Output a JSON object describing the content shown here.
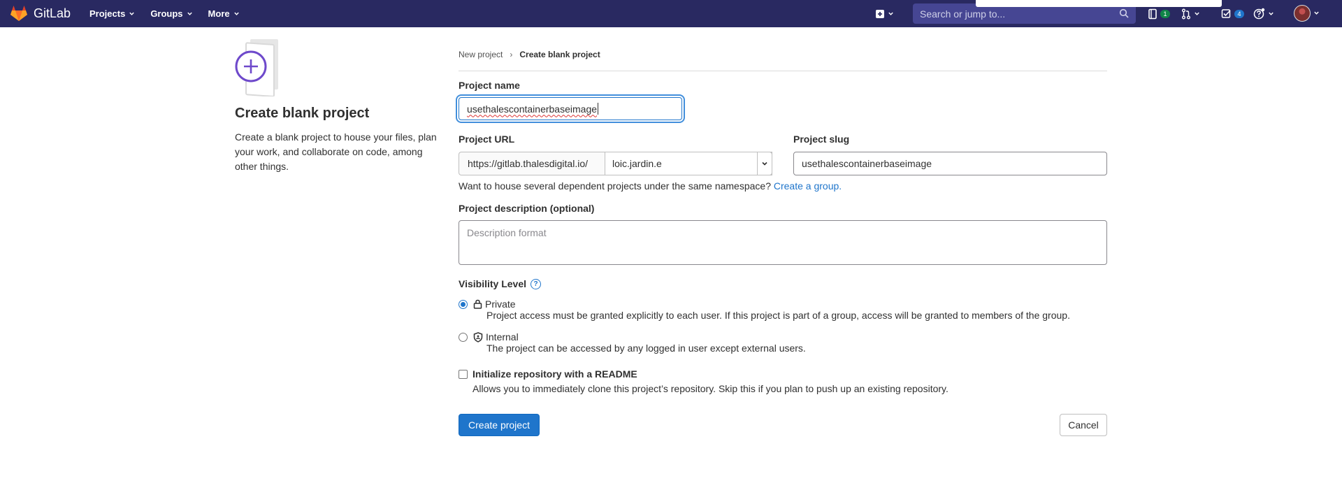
{
  "navbar": {
    "brand": "GitLab",
    "menu": [
      {
        "label": "Projects"
      },
      {
        "label": "Groups"
      },
      {
        "label": "More"
      }
    ],
    "search_placeholder": "Search or jump to...",
    "issues_count": "1",
    "todos_count": "4"
  },
  "sidebar": {
    "title": "Create blank project",
    "description": "Create a blank project to house your files, plan your work, and collaborate on code, among other things."
  },
  "breadcrumb": {
    "parent": "New project",
    "separator": "›",
    "current": "Create blank project"
  },
  "form": {
    "project_name_label": "Project name",
    "project_name_value": "usethalescontainerbaseimage",
    "project_url_label": "Project URL",
    "url_prefix": "https://gitlab.thalesdigital.io/",
    "namespace": "loic.jardin.e",
    "project_slug_label": "Project slug",
    "project_slug_value": "usethalescontainerbaseimage",
    "namespace_help": "Want to house several dependent projects under the same namespace?",
    "create_group_link": "Create a group.",
    "description_label": "Project description (optional)",
    "description_placeholder": "Description format",
    "visibility_label": "Visibility Level",
    "visibility_options": [
      {
        "title": "Private",
        "description": "Project access must be granted explicitly to each user. If this project is part of a group, access will be granted to members of the group.",
        "checked": true,
        "icon": "lock-icon"
      },
      {
        "title": "Internal",
        "description": "The project can be accessed by any logged in user except external users.",
        "checked": false,
        "icon": "shield-icon"
      }
    ],
    "readme_label": "Initialize repository with a README",
    "readme_description": "Allows you to immediately clone this project’s repository. Skip this if you plan to push up an existing repository.",
    "create_button": "Create project",
    "cancel_button": "Cancel"
  },
  "colors": {
    "navbar_bg": "#292961",
    "primary": "#1f75cb",
    "focus_ring": "#428fdc",
    "issues_badge": "#108548",
    "todos_badge": "#1f75cb"
  }
}
